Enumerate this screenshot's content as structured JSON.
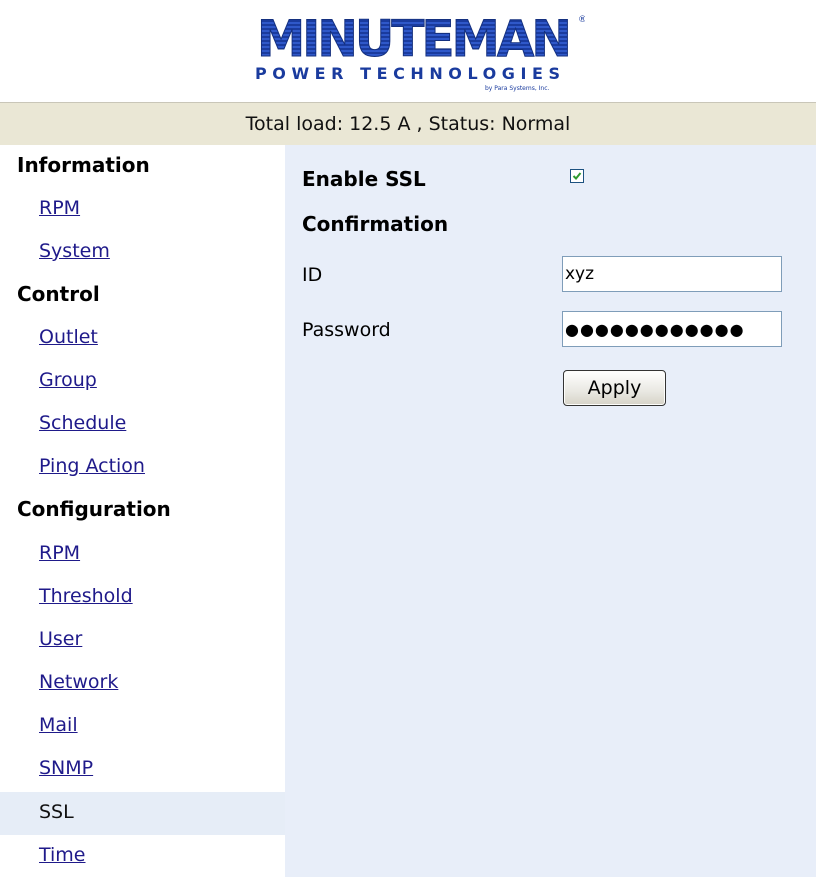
{
  "brand": {
    "logo_main": "MINUTEMAN",
    "logo_sub": "POWER TECHNOLOGIES",
    "logo_tag": "by Para Systems, Inc."
  },
  "status": {
    "text": "Total load: 12.5 A , Status: Normal"
  },
  "sidebar": {
    "information": "Information",
    "info_items": [
      "RPM",
      "System"
    ],
    "control": "Control",
    "control_items": [
      "Outlet",
      "Group",
      "Schedule",
      "Ping Action"
    ],
    "configuration": "Configuration",
    "config_items": [
      "RPM",
      "Threshold",
      "User",
      "Network",
      "Mail",
      "SNMP",
      "SSL",
      "Time"
    ],
    "active_item": "SSL"
  },
  "form": {
    "enable_ssl_label": "Enable SSL",
    "enable_ssl_checked": true,
    "confirmation_label": "Confirmation",
    "id_label": "ID",
    "id_value": "xyz",
    "password_label": "Password",
    "password_value": "●●●●●●●●●●●●",
    "apply_label": "Apply"
  },
  "colors": {
    "status_bg": "#eae7d5",
    "panel_bg": "#e8eef9",
    "active_bg": "#e6edf7",
    "link": "#1f1a8a",
    "logo_blue": "#1a3b9e",
    "check_green": "#2e9a2e"
  }
}
